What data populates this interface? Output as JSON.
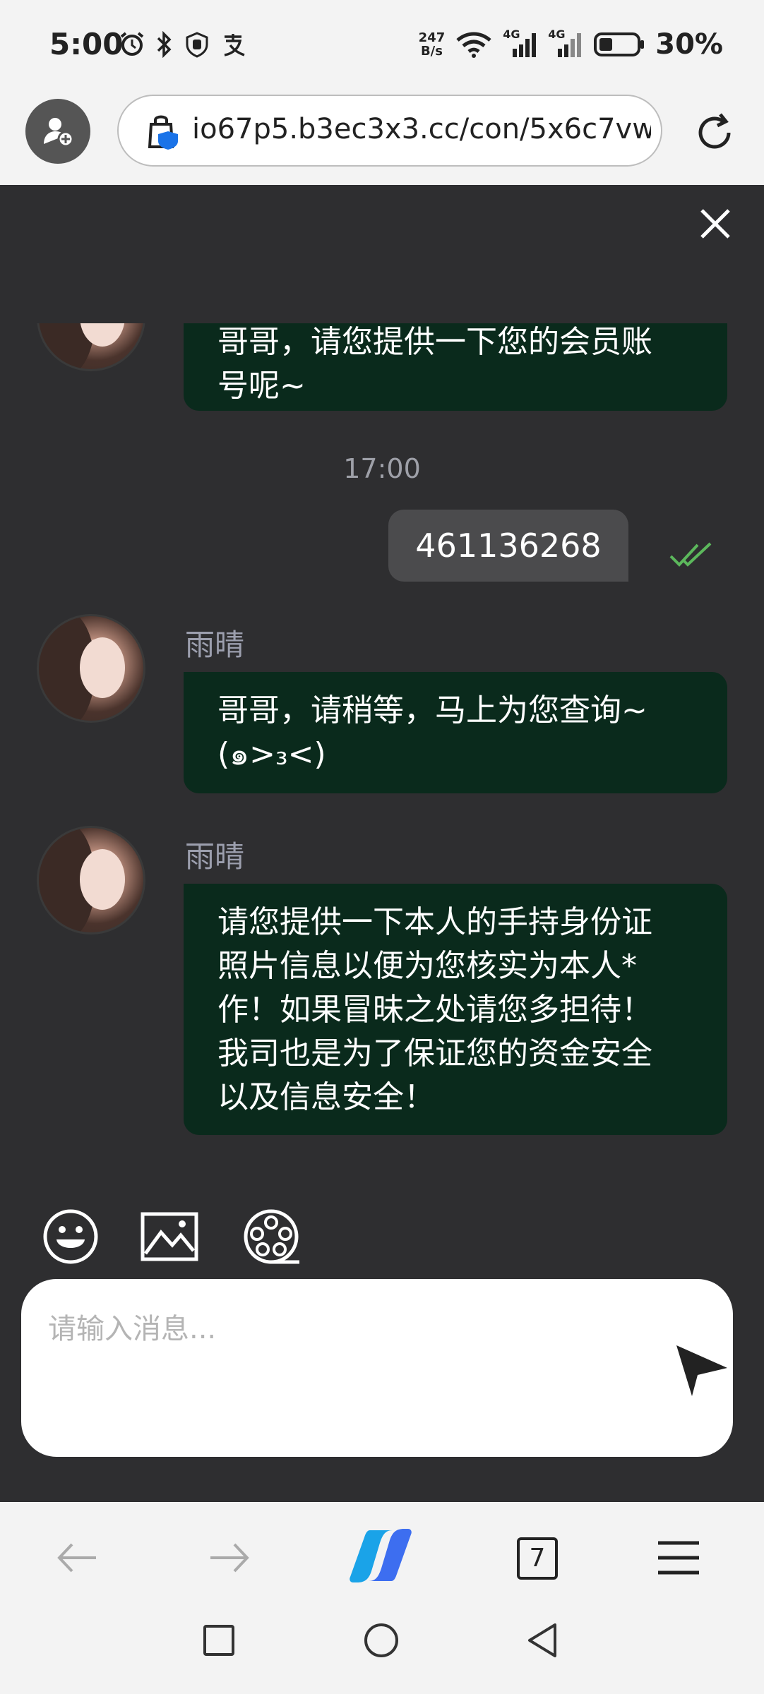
{
  "status_bar": {
    "time": "5:00",
    "net_speed_value": "247",
    "net_speed_unit": "B/s",
    "network_1": "4G",
    "network_2": "4G",
    "battery": "30%"
  },
  "browser": {
    "url": "io67p5.b3ec3x3.cc/con/5x6c7vw",
    "tab_count": "7"
  },
  "chat": {
    "messages": [
      {
        "type": "incoming",
        "text_line1": "哥哥，请您提供一下您的会员账",
        "text_line2": "号呢~"
      },
      {
        "type": "time",
        "text": "17:00"
      },
      {
        "type": "outgoing",
        "text": "461136268",
        "status": "read"
      },
      {
        "type": "incoming",
        "sender": "雨晴",
        "text_line1": "哥哥，请稍等，马上为您查询~",
        "text_line2": "(๑>₃<)"
      },
      {
        "type": "incoming",
        "sender": "雨晴",
        "lines": [
          "请您提供一下本人的手持身份证",
          "照片信息以便为您核实为本人*",
          "作！如果冒昧之处请您多担待！",
          "我司也是为了保证您的资金安全",
          "以及信息安全！"
        ]
      }
    ],
    "input_placeholder": "请输入消息..."
  },
  "colors": {
    "chat_bg": "#2e2e30",
    "incoming_bubble": "#0a2a1c",
    "outgoing_bubble": "#4b4b4d",
    "read_check": "#5cb85c"
  }
}
